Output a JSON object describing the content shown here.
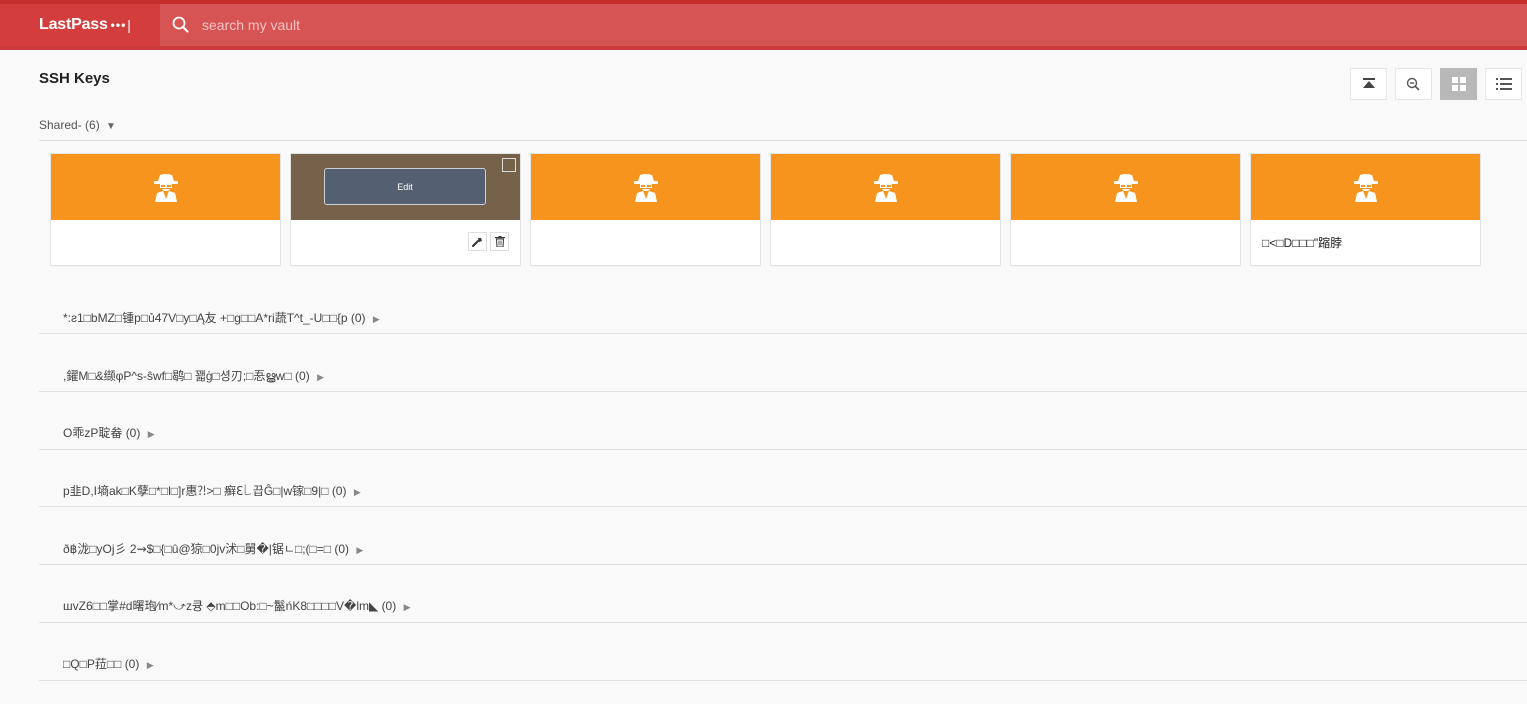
{
  "header": {
    "brand": "LastPass",
    "brand_dots": "•••",
    "brand_bar": "|",
    "search_placeholder": "search my vault",
    "colors": {
      "bar": "#d75454",
      "brand_bg": "#d43d3d"
    }
  },
  "page": {
    "title": "SSH Keys",
    "tools": [
      {
        "name": "collapse-all-icon"
      },
      {
        "name": "zoom-out-icon"
      },
      {
        "name": "grid-view-icon",
        "active": true
      },
      {
        "name": "list-view-icon"
      }
    ]
  },
  "group": {
    "label": "Shared- (6)",
    "toggle": "▼"
  },
  "cards": [
    {
      "name": "",
      "icon": "agent-icon"
    },
    {
      "name": "",
      "hover": true,
      "edit_label": "Edit"
    },
    {
      "name": "",
      "icon": "agent-icon"
    },
    {
      "name": "",
      "icon": "agent-icon"
    },
    {
      "name": "",
      "icon": "agent-icon"
    },
    {
      "name": "□<□D□□□\"蹜脖",
      "icon": "agent-icon"
    }
  ],
  "folders": [
    {
      "label": "*:ƨ1□bMZ□锺p□ủ47V□y□Ą友 +□g□□A*ri蔬T^t_-U□□{p",
      "count": "(0)"
    },
    {
      "label": ",鑃M□&缬φP^s-ŝwf□鹖□ 꽯ģ□셩刃;□忢ൠw□",
      "count": "(0)"
    },
    {
      "label": "O乖zP聢畚",
      "count": "(0)"
    },
    {
      "label": "p韭D,I墒ak□K孽□*□l□]r惠⁈>□ 癣ℇ꒒끕Ĝ□|w镓□9|□",
      "count": "(0)"
    },
    {
      "label": "ð฿泷□yOj彡 2⇝$□{□û@猄□0jv沭□舅�|锯ㄴ□;(□=□",
      "count": "(0)"
    },
    {
      "label": "шvZ6□□掌#d曙玸⁄m*⤻z큥 ⬘m□□Ob:□~鬣ńK8□□□□V�lm◣",
      "count": "(0)"
    },
    {
      "label": "□Q□P菈□□",
      "count": "(0)"
    }
  ],
  "folder_toggle": "▶",
  "colors": {
    "card_orange": "#f7941d",
    "hover": "#76624a"
  }
}
